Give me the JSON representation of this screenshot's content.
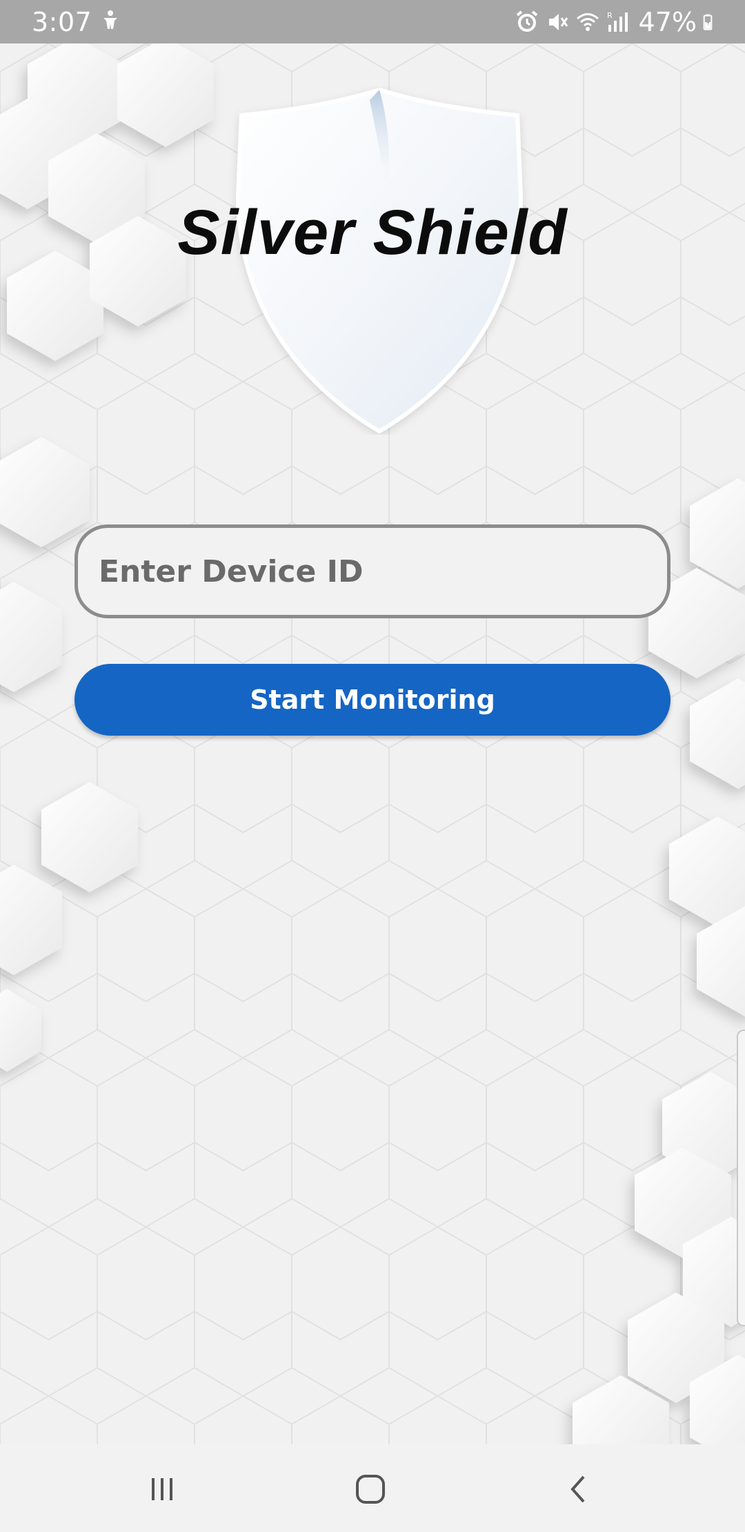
{
  "status_bar": {
    "time": "3:07",
    "battery_text": "47%",
    "icons": [
      "accessibility-icon",
      "alarm-icon",
      "mute-icon",
      "wifi-icon",
      "signal-icon",
      "battery-icon"
    ]
  },
  "app": {
    "title": "Silver Shield"
  },
  "device_id": {
    "placeholder": "Enter Device ID",
    "value": ""
  },
  "start_button": {
    "label": "Start Monitoring"
  },
  "colors": {
    "accent": "#1565c4",
    "background": "#f1f1f1",
    "status_bar": "#a7a7a7"
  },
  "nav_bar": {
    "icons": [
      "recents-icon",
      "home-icon",
      "back-icon"
    ]
  }
}
